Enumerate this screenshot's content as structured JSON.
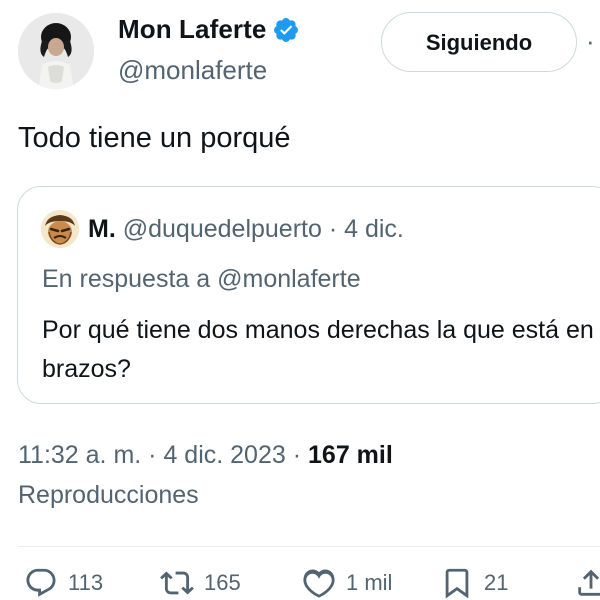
{
  "author": {
    "name": "Mon Laferte",
    "handle": "@monlaferte",
    "verified": true
  },
  "follow_button": {
    "label": "Siguiendo"
  },
  "more_button": {
    "label": "·"
  },
  "tweet": {
    "text": "Todo tiene un porqué"
  },
  "quote": {
    "name": "M.",
    "handle": "@duquedelpuerto",
    "separator": "·",
    "date": "4 dic.",
    "reply_to": "En respuesta a @monlaferte",
    "text": "Por qué tiene dos manos derechas la que está en brazos?"
  },
  "meta": {
    "time": "11:32 a. m.",
    "sep1": "·",
    "date": "4 dic. 2023",
    "sep2": "·",
    "views_count": "167 mil",
    "views_label": "Reproducciones"
  },
  "actions": {
    "replies": "113",
    "retweets": "165",
    "likes": "1 mil",
    "bookmarks": "21"
  },
  "colors": {
    "verified_blue": "#1d9bf0",
    "secondary_text": "#536471",
    "primary_text": "#0f1419",
    "border": "#cfd9de"
  }
}
